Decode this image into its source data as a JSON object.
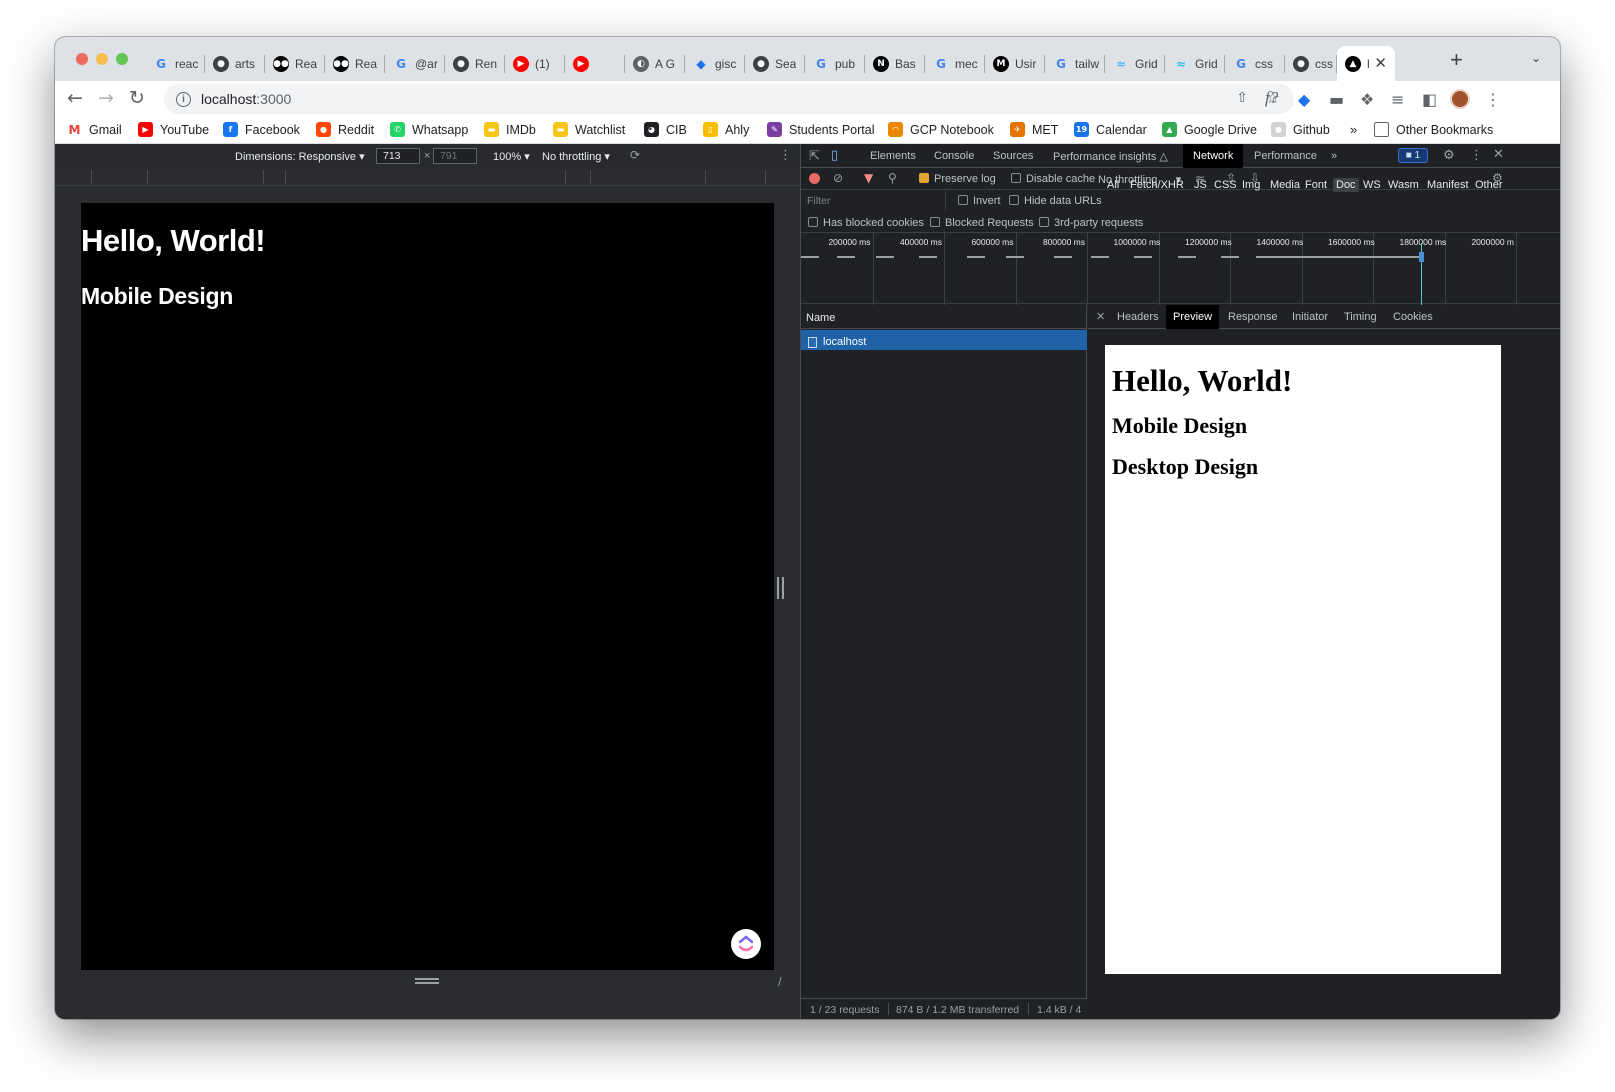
{
  "tabs": [
    {
      "title": "reac",
      "icon": "google-icon",
      "color": "#4285f4"
    },
    {
      "title": "arts",
      "icon": "github-icon",
      "color": "#3c4043"
    },
    {
      "title": "Rea",
      "icon": "medium-icon",
      "color": "#000000"
    },
    {
      "title": "Rea",
      "icon": "medium-icon",
      "color": "#000000"
    },
    {
      "title": "@ar",
      "icon": "google-icon",
      "color": "#4285f4"
    },
    {
      "title": "Ren",
      "icon": "github-icon",
      "color": "#3c4043"
    },
    {
      "title": "(1)",
      "icon": "youtube-icon",
      "color": "#ff0000"
    },
    {
      "title": "",
      "icon": "youtube-icon",
      "color": "#ff0000"
    },
    {
      "title": "A G",
      "icon": "profile-icon",
      "color": "#5f6368"
    },
    {
      "title": "gisc",
      "icon": "diamond-icon",
      "color": "#1a73e8"
    },
    {
      "title": "Sea",
      "icon": "github-icon",
      "color": "#3c4043"
    },
    {
      "title": "pub",
      "icon": "google-icon",
      "color": "#4285f4"
    },
    {
      "title": "Bas",
      "icon": "nextjs-icon",
      "color": "#000000"
    },
    {
      "title": "mec",
      "icon": "google-icon",
      "color": "#4285f4"
    },
    {
      "title": "Usir",
      "icon": "m-logo-icon",
      "color": "#000000"
    },
    {
      "title": "tailw",
      "icon": "google-icon",
      "color": "#4285f4"
    },
    {
      "title": "Grid",
      "icon": "tailwind-icon",
      "color": "#38bdf8"
    },
    {
      "title": "Grid",
      "icon": "tailwind-icon",
      "color": "#38bdf8"
    },
    {
      "title": "css",
      "icon": "google-icon",
      "color": "#4285f4"
    },
    {
      "title": "css",
      "icon": "github-icon",
      "color": "#3c4043"
    },
    {
      "title": "l",
      "icon": "vercel-icon",
      "color": "#000000"
    }
  ],
  "toolbar": {
    "url_host": "localhost",
    "url_port": ":3000"
  },
  "bookmarks": [
    {
      "label": "Gmail",
      "icon": "gmail-icon",
      "color": "#ea4335"
    },
    {
      "label": "YouTube",
      "icon": "youtube-icon",
      "color": "#ff0000"
    },
    {
      "label": "Facebook",
      "icon": "facebook-icon",
      "color": "#1877f2"
    },
    {
      "label": "Reddit",
      "icon": "reddit-icon",
      "color": "#ff4500"
    },
    {
      "label": "Whatsapp",
      "icon": "whatsapp-icon",
      "color": "#25d366"
    },
    {
      "label": "IMDb",
      "icon": "imdb-icon",
      "color": "#f5c518"
    },
    {
      "label": "Watchlist",
      "icon": "imdb-icon",
      "color": "#f5c518"
    },
    {
      "label": "CIB",
      "icon": "globe-icon",
      "color": "#202124"
    },
    {
      "label": "Ahly",
      "icon": "bookmark-icon",
      "color": "#fbbc04"
    },
    {
      "label": "Students Portal",
      "icon": "feather-icon",
      "color": "#7b3fa1"
    },
    {
      "label": "GCP Notebook",
      "icon": "gcp-icon",
      "color": "#ea8600"
    },
    {
      "label": "MET",
      "icon": "met-icon",
      "color": "#e37400"
    },
    {
      "label": "Calendar",
      "icon": "calendar-icon",
      "color": "#1a73e8"
    },
    {
      "label": "Google Drive",
      "icon": "drive-icon",
      "color": "#34a853"
    },
    {
      "label": "Github",
      "icon": "github-icon",
      "color": "#d0d2d6"
    }
  ],
  "bookmarks_overflow": "»",
  "other_bookmarks": "Other Bookmarks",
  "device_toolbar": {
    "dimensions": "Dimensions: Responsive",
    "width": "713",
    "times": "×",
    "height": "791",
    "zoom": "100%",
    "throttling": "No throttling"
  },
  "viewport": {
    "heading": "Hello, World!",
    "subheading": "Mobile Design"
  },
  "devtools": {
    "tabs": [
      "Elements",
      "Console",
      "Sources",
      "Performance insights",
      "Network",
      "Performance"
    ],
    "active_tab": "Network",
    "issues_badge": "1",
    "network_toolbar": {
      "preserve_log": "Preserve log",
      "disable_cache": "Disable cache",
      "throttling": "No throttling"
    },
    "filter": {
      "placeholder": "Filter",
      "invert": "Invert",
      "hide_data_urls": "Hide data URLs",
      "types": [
        "All",
        "Fetch/XHR",
        "JS",
        "CSS",
        "Img",
        "Media",
        "Font",
        "Doc",
        "WS",
        "Wasm",
        "Manifest",
        "Other"
      ],
      "selected_type": "Doc",
      "has_blocked_cookies": "Has blocked cookies",
      "blocked_requests": "Blocked Requests",
      "third_party": "3rd-party requests"
    },
    "timeline_ticks": [
      "200000 ms",
      "400000 ms",
      "600000 ms",
      "800000 ms",
      "1000000 ms",
      "1200000 ms",
      "1400000 ms",
      "1600000 ms",
      "1800000 ms",
      "2000000 m"
    ],
    "requests": {
      "column_name": "Name",
      "rows": [
        "localhost"
      ]
    },
    "detail_tabs": [
      "Headers",
      "Preview",
      "Response",
      "Initiator",
      "Timing",
      "Cookies"
    ],
    "active_detail_tab": "Preview",
    "preview": {
      "h1": "Hello, World!",
      "h2_1": "Mobile Design",
      "h2_2": "Desktop Design"
    },
    "status": {
      "requests": "1 / 23 requests",
      "transferred": "874 B / 1.2 MB transferred",
      "resources": "1.4 kB / 4"
    }
  }
}
